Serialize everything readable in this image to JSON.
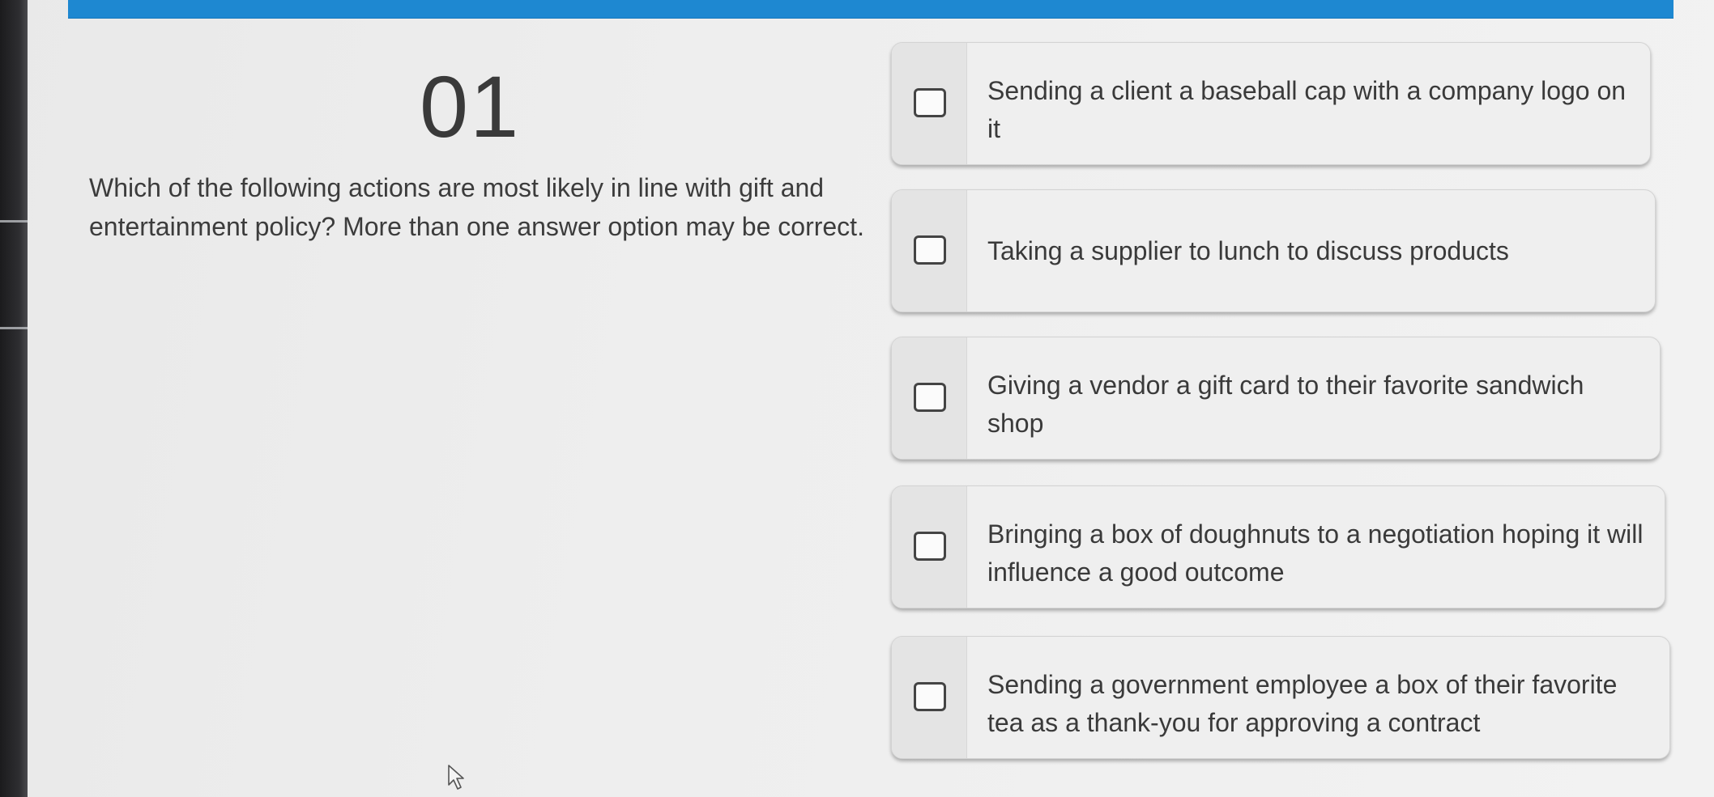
{
  "question": {
    "number": "01",
    "prompt": "Which of the following actions are most likely in line with gift and entertainment policy? More than one answer option may be correct."
  },
  "options": [
    {
      "label": "Sending a client a baseball cap with a company logo on it",
      "checked": false
    },
    {
      "label": "Taking a supplier to lunch to discuss products",
      "checked": false
    },
    {
      "label": "Giving a vendor a gift card to their favorite sandwich shop",
      "checked": false
    },
    {
      "label": "Bringing a box of doughnuts to a negotiation hoping it will influence a good outcome",
      "checked": false
    },
    {
      "label": "Sending a government employee a box of their favorite tea as a thank-you for approving a contract",
      "checked": false
    }
  ],
  "colors": {
    "header_bar": "#1e88d1",
    "text": "#3a3a3a",
    "option_bg": "#efefef"
  }
}
